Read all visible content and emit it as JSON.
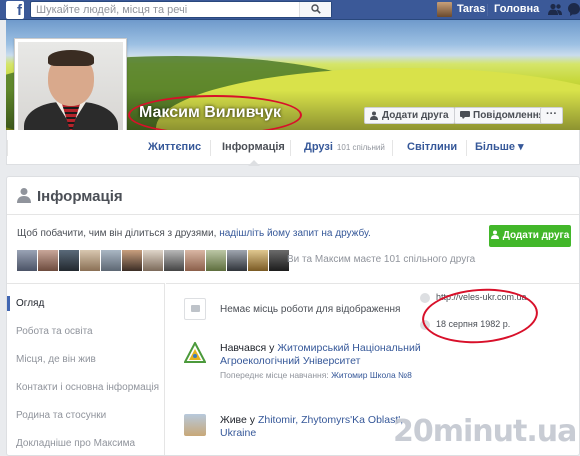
{
  "topbar": {
    "logo": "f",
    "search_placeholder": "Шукайте людей, місця та речі",
    "user_name": "Taras",
    "home_label": "Головна"
  },
  "profile": {
    "name": "Максим Виливчук",
    "add_friend_label": "Додати друга",
    "message_label": "Повідомлення",
    "more_label": "···"
  },
  "tabs": [
    {
      "label": "Життєпис"
    },
    {
      "label": "Інформація"
    },
    {
      "label": "Друзі",
      "count": "101 спільний"
    },
    {
      "label": "Світлини"
    },
    {
      "label": "Більше ▾"
    }
  ],
  "info": {
    "title": "Інформація",
    "notice_text": "Щоб побачити, чим він ділиться з друзями, ",
    "notice_link": "надішліть йому запит на дружбу.",
    "add_friend_label": "Додати друга",
    "mutual_text": "Ви та Максим маєте 101 спільного друга",
    "nav": [
      "Огляд",
      "Робота та освіта",
      "Місця, де він жив",
      "Контакти і основна інформація",
      "Родина та стосунки",
      "Докладніше про Максима"
    ],
    "work_text": "Немає місць роботи для відображення",
    "website": "http://veles-ukr.com.ua",
    "birthday": "18 серпня 1982 р.",
    "edu_prefix": "Навчався у ",
    "edu_link": "Житомирський Національний Агроекологічний Університет",
    "edu_sub_prefix": "Попереднє місце навчання: ",
    "edu_sub_link": "Житомир Школа №8",
    "lives_prefix": "Живе у ",
    "lives_link": "Zhitomir, Zhytomyrs'Ka Oblast', Ukraine"
  },
  "watermark": "20minut.ua",
  "colors": {
    "fb_blue": "#3b5998",
    "link_blue": "#365899",
    "green_button": "#42b72a",
    "annotation_red": "#d8102a"
  }
}
